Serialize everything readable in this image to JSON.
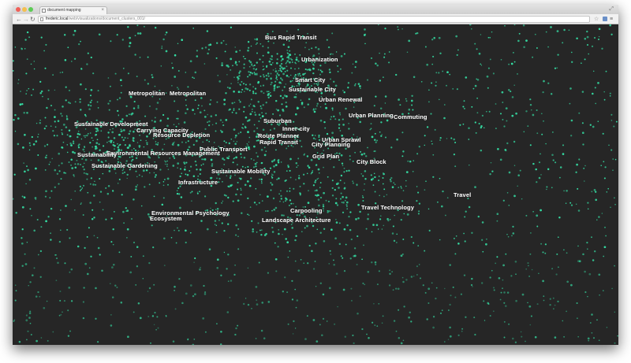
{
  "browser": {
    "tab_title": "document mapping",
    "tab_close": "×",
    "url_host": "frederic.local",
    "url_path": "/web/visualizations/document_clusters_001/",
    "nav_back": "←",
    "nav_forward": "→",
    "nav_reload": "↻",
    "star": "☆",
    "menu": "≡",
    "resize": "⤢"
  },
  "visualization": {
    "dot_color": "#35e0a5",
    "background_color": "#262626",
    "labels": [
      "Bus Rapid Transit",
      "Urbanization",
      "Smart City",
      "Sustainable City",
      "Metropolitan",
      "Metropolitan",
      "Urban Renewal",
      "Urban Planning",
      "Commuting",
      "Sustainable Development",
      "Suburban",
      "Carrying Capacity",
      "Inner-city",
      "Resource Depletion",
      "Route Planner",
      "Rapid Transit",
      "Urban Sprawl",
      "City Planning",
      "Public Transport",
      "Environmental Resources Management",
      "Sustainability",
      "Grid Plan",
      "City Block",
      "Sustainable Gardening",
      "Sustainable Mobility",
      "Infrastructure",
      "Travel",
      "Travel Technology",
      "Carpooling",
      "Environmental Psychology",
      "Ecosystem",
      "Landscape Architecture"
    ]
  }
}
